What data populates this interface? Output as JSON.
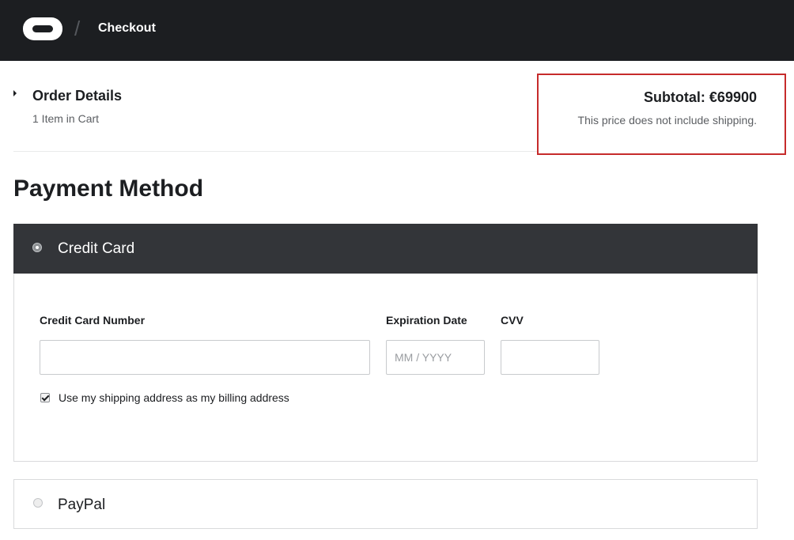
{
  "header": {
    "logo_icon": "oculus-logo-icon",
    "separator": "/",
    "breadcrumb": "Checkout"
  },
  "order": {
    "title": "Order Details",
    "item_count": "1 Item in Cart",
    "toggle_icon": "caret-right-icon"
  },
  "summary": {
    "subtotal": "Subtotal: €69900",
    "note": "This price does not include shipping.",
    "highlight_color": "#c62b2b"
  },
  "payment": {
    "title": "Payment Method",
    "credit_card": {
      "label": "Credit Card",
      "selected": true,
      "card_number_label": "Credit Card Number",
      "card_number_value": "",
      "expiration_label": "Expiration Date",
      "expiration_placeholder": "MM / YYYY",
      "cvv_label": "CVV",
      "cvv_value": "",
      "billing_checkbox_label": "Use my shipping address as my billing address",
      "billing_checked": true
    },
    "paypal": {
      "label": "PayPal",
      "selected": false
    }
  },
  "colors": {
    "header_bg": "#1c1e21",
    "selected_method_bg": "#333539"
  }
}
